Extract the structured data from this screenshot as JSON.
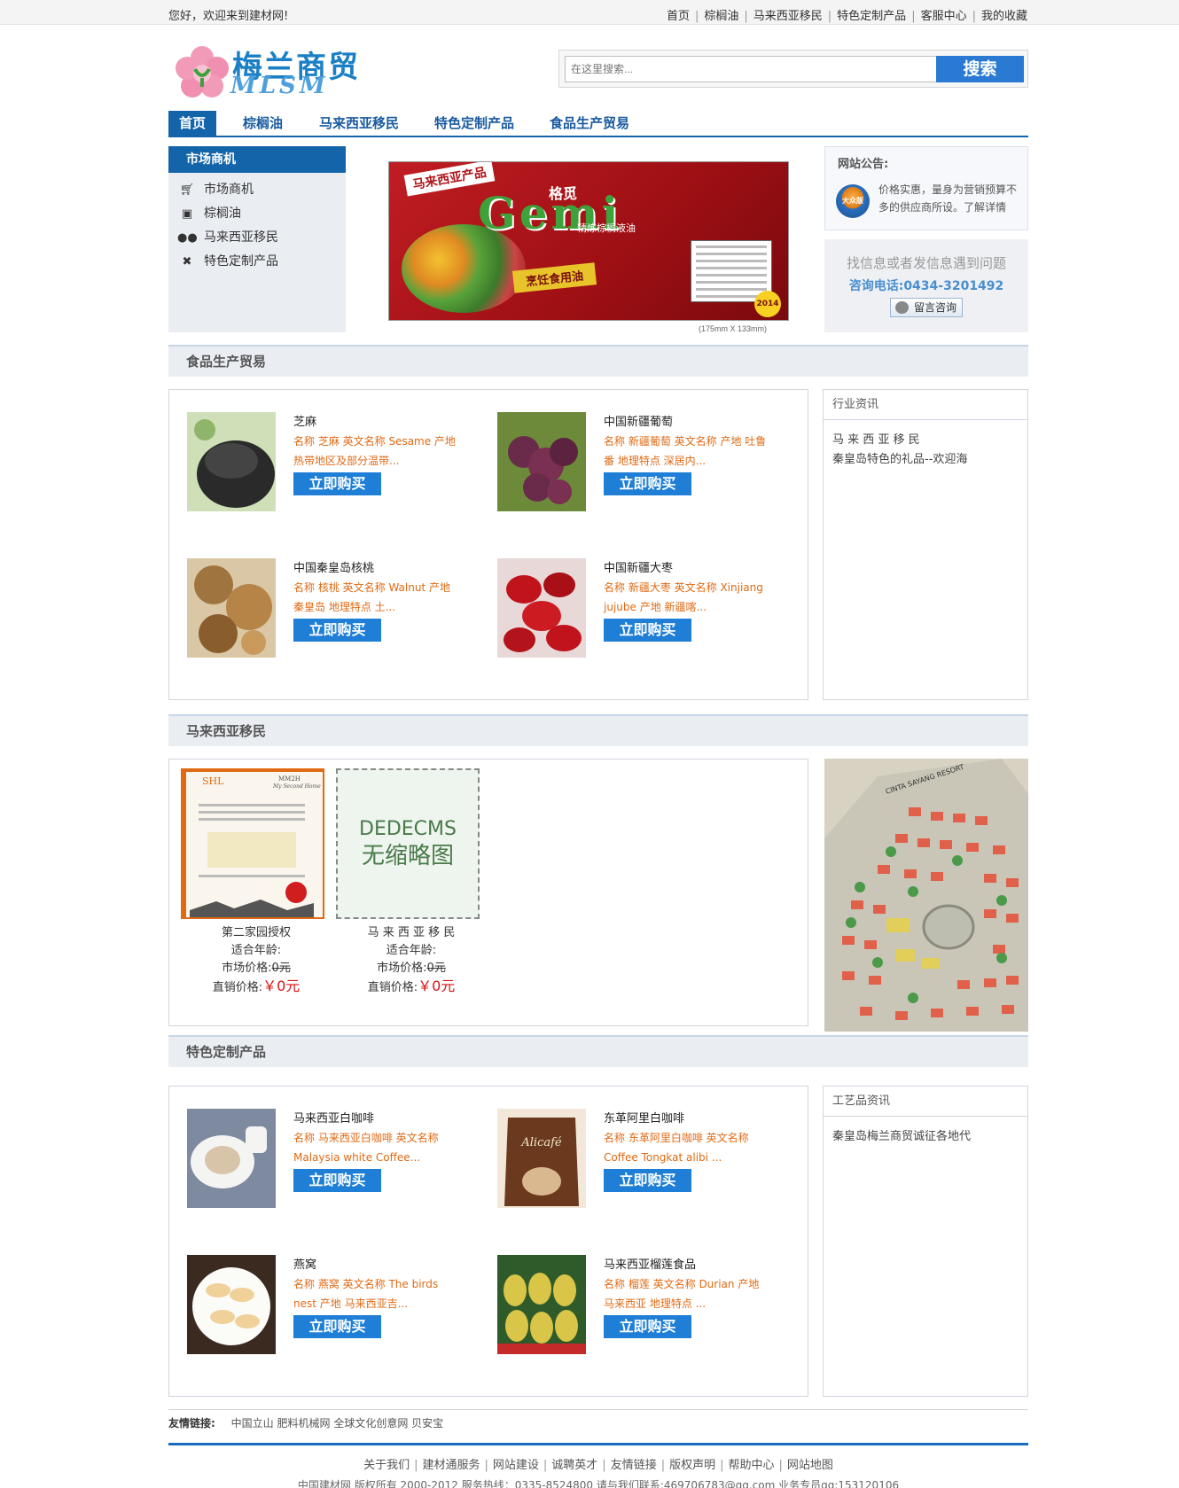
{
  "topbar": {
    "welcome": "您好，欢迎来到建材网!",
    "links": [
      "首页",
      "棕榈油",
      "马来西亚移民",
      "特色定制产品",
      "客服中心",
      "我的收藏"
    ]
  },
  "logo": {
    "cn": "梅兰商贸",
    "en": "MLSM"
  },
  "search": {
    "placeholder": "在这里搜索...",
    "button": "搜索"
  },
  "nav": {
    "items": [
      "首页",
      "棕榈油",
      "马来西亚移民",
      "特色定制产品",
      "食品生产贸易"
    ]
  },
  "leftbox": {
    "title": "市场商机",
    "items": [
      {
        "label": "市场商机",
        "icon": "cart-icon"
      },
      {
        "label": "棕榈油",
        "icon": "truck-icon"
      },
      {
        "label": "马来西亚移民",
        "icon": "users-icon"
      },
      {
        "label": "特色定制产品",
        "icon": "tools-icon"
      }
    ]
  },
  "banner": {
    "tag": "马来西亚产品",
    "brand": "Gemi",
    "brand_cn": "格觅",
    "sub": "精炼棕榈液油",
    "slogan": "烹饪食用油",
    "badge": "2014",
    "caption": "(175mm X 133mm)"
  },
  "notice": {
    "title": "网站公告:",
    "icon_label": "大众版",
    "text": "价格实惠，量身为营销预算不多的供应商所设。了解详情"
  },
  "consult": {
    "line1": "找信息或者发信息遇到问题",
    "line2": "咨询电话:0434-3201492",
    "button": "留言咨询"
  },
  "sections": {
    "food": {
      "title": "食品生产贸易",
      "products": [
        {
          "name": "芝麻",
          "desc": "名称 芝麻 英文名称 Sesame 产地 热带地区及部分温带...",
          "button": "立即购买"
        },
        {
          "name": "中国新疆葡萄",
          "desc": "名称 新疆葡萄 英文名称 产地 吐鲁番 地理特点 深居内...",
          "button": "立即购买"
        },
        {
          "name": "中国秦皇岛核桃",
          "desc": "名称 核桃 英文名称 Walnut 产地 秦皇岛 地理特点 土...",
          "button": "立即购买"
        },
        {
          "name": "中国新疆大枣",
          "desc": "名称 新疆大枣 英文名称 Xinjiang jujube 产地 新疆喀...",
          "button": "立即购买"
        }
      ],
      "side_title": "行业资讯",
      "side_items": [
        "马 来 西 亚 移 民",
        "秦皇岛特色的礼品--欢迎海"
      ]
    },
    "migration": {
      "title": "马来西亚移民",
      "items": [
        {
          "name": "第二家园授权",
          "age_label": "适合年龄:",
          "market_label": "市场价格:",
          "market_price": "0元",
          "direct_label": "直销价格:",
          "direct_price": "￥0元"
        },
        {
          "name": "马 来 西 亚 移 民",
          "placeholder": "DEDECMS\n无缩略图",
          "ph1": "DEDECMS",
          "ph2": "无缩略图",
          "age_label": "适合年龄:",
          "market_label": "市场价格:",
          "market_price": "0元",
          "direct_label": "直销价格:",
          "direct_price": "￥0元"
        }
      ],
      "cert": {
        "logo": "SHL",
        "brand": "MM2H",
        "sub": "My Second Home"
      },
      "map_text": "CINTA SAYANG RESORT"
    },
    "custom": {
      "title": "特色定制产品",
      "products": [
        {
          "name": "马来西亚白咖啡",
          "desc": "名称 马来西亚白咖啡 英文名称 Malaysia white Coffee...",
          "button": "立即购买"
        },
        {
          "name": "东革阿里白咖啡",
          "desc": "名称 东革阿里白咖啡 英文名称 Coffee Tongkat alibi ...",
          "button": "立即购买",
          "pack": "Alicafé"
        },
        {
          "name": "燕窝",
          "desc": "名称 燕窝 英文名称 The birds nest 产地 马来西亚吉...",
          "button": "立即购买"
        },
        {
          "name": "马来西亚榴莲食品",
          "desc": "名称 榴莲 英文名称 Durian 产地 马来西亚 地理特点 ...",
          "button": "立即购买"
        }
      ],
      "side_title": "工艺品资讯",
      "side_items": [
        "秦皇岛梅兰商贸诚征各地代"
      ]
    }
  },
  "friends": {
    "label": "友情链接:",
    "links": [
      "中国立山",
      "肥料机械网",
      "全球文化创意网",
      "贝安宝"
    ]
  },
  "footer": {
    "links": [
      "关于我们",
      "建材通服务",
      "网站建设",
      "诚聘英才",
      "友情链接",
      "版权声明",
      "帮助中心",
      "网站地图"
    ],
    "copyright": "中国建材网 版权所有 2000-2012 服务热线：0335-8524800 请与我们联系:469706783@qq.com 业务专员qq:153120106"
  },
  "colors": {
    "accent": "#1464aa",
    "button": "#1f7fd6",
    "desc": "#e06a14",
    "price": "#d81313"
  }
}
